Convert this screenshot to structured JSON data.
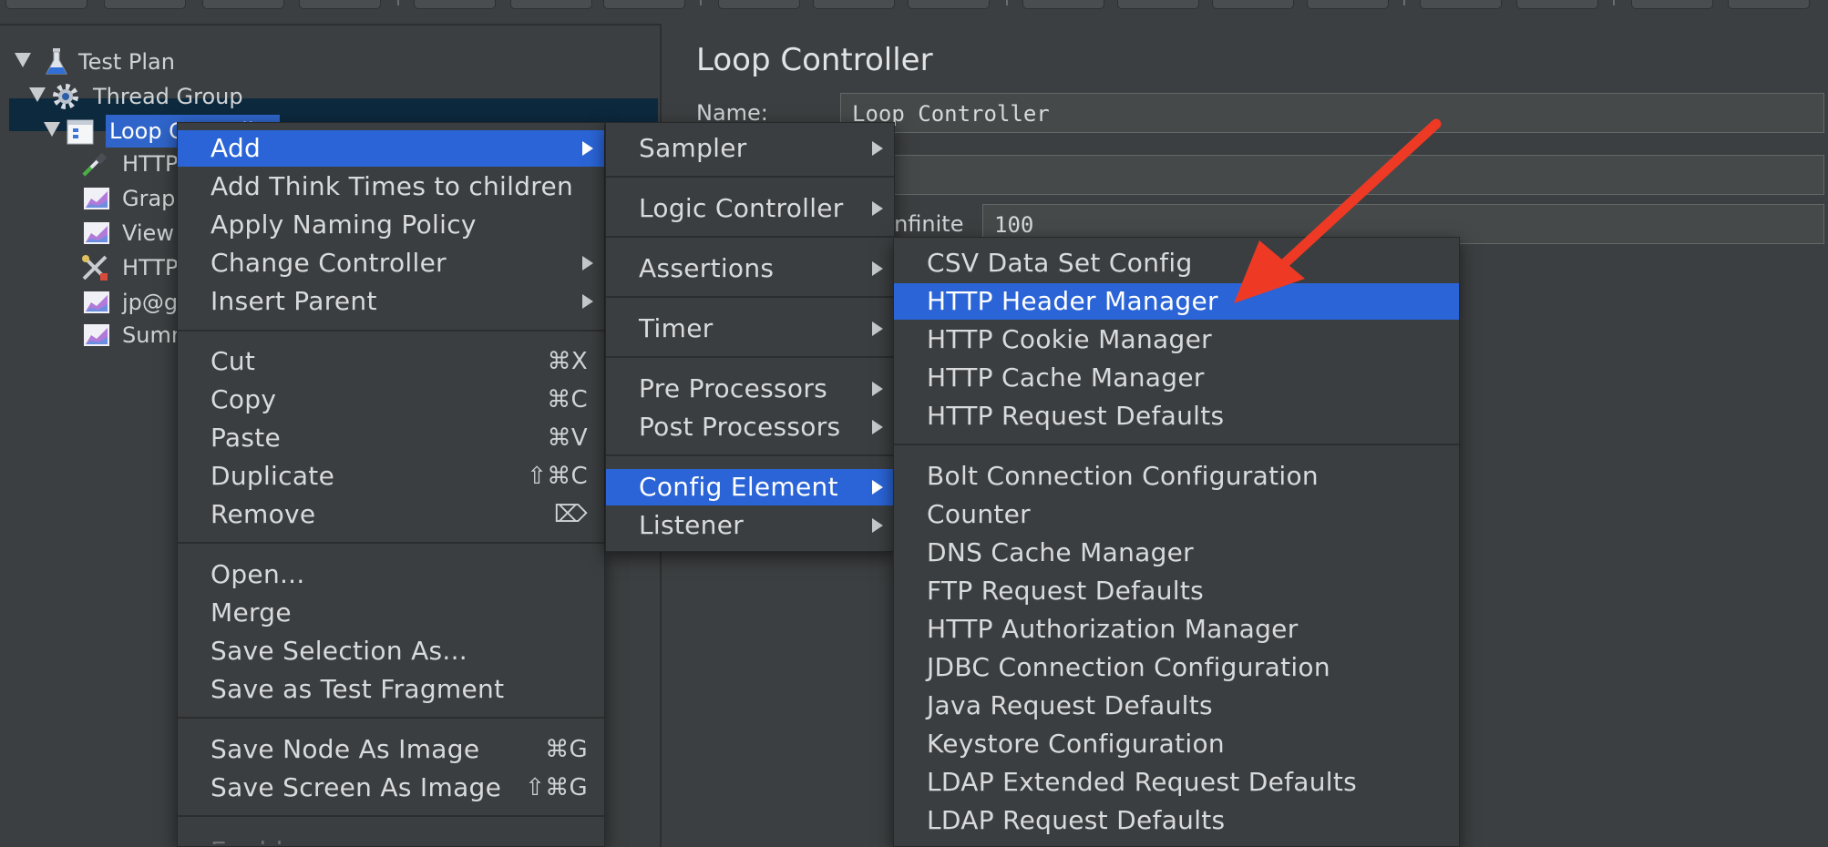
{
  "tree": {
    "nodes": [
      {
        "label": "Test Plan",
        "icon": "flask-icon"
      },
      {
        "label": "Thread Group",
        "icon": "gear-icon"
      },
      {
        "label": "Loop Controller",
        "icon": "loop-controller-icon"
      },
      {
        "label": "HTTP",
        "icon": "pipette-icon"
      },
      {
        "label": "Grap",
        "icon": "graph-listener-icon"
      },
      {
        "label": "View",
        "icon": "graph-listener-icon"
      },
      {
        "label": "HTTP",
        "icon": "tools-icon"
      },
      {
        "label": "jp@g",
        "icon": "graph-listener-icon"
      },
      {
        "label": "Summ",
        "icon": "graph-listener-icon"
      }
    ]
  },
  "panel": {
    "title": "Loop Controller",
    "name_label": "Name:",
    "name_value": "Loop Controller",
    "infinite_label": "Infinite",
    "loop_value": "100"
  },
  "context_menu": {
    "items": [
      {
        "label": "Add",
        "submenu": true,
        "highlighted": true
      },
      {
        "label": "Add Think Times to children"
      },
      {
        "label": "Apply Naming Policy"
      },
      {
        "label": "Change Controller",
        "submenu": true
      },
      {
        "label": "Insert Parent",
        "submenu": true
      },
      {
        "label": "Cut",
        "shortcut": "⌘X"
      },
      {
        "label": "Copy",
        "shortcut": "⌘C"
      },
      {
        "label": "Paste",
        "shortcut": "⌘V"
      },
      {
        "label": "Duplicate",
        "shortcut": "⇧⌘C"
      },
      {
        "label": "Remove",
        "shortcut": "⌦"
      },
      {
        "label": "Open..."
      },
      {
        "label": "Merge"
      },
      {
        "label": "Save Selection As..."
      },
      {
        "label": "Save as Test Fragment"
      },
      {
        "label": "Save Node As Image",
        "shortcut": "⌘G"
      },
      {
        "label": "Save Screen As Image",
        "shortcut": "⇧⌘G"
      },
      {
        "label": "Enable"
      }
    ]
  },
  "add_submenu": {
    "items": [
      {
        "label": "Sampler"
      },
      {
        "label": "Logic Controller"
      },
      {
        "label": "Assertions"
      },
      {
        "label": "Timer"
      },
      {
        "label": "Pre Processors"
      },
      {
        "label": "Post Processors"
      },
      {
        "label": "Config Element",
        "highlighted": true
      },
      {
        "label": "Listener"
      }
    ]
  },
  "config_submenu": {
    "items": [
      {
        "label": "CSV Data Set Config"
      },
      {
        "label": "HTTP Header Manager",
        "highlighted": true
      },
      {
        "label": "HTTP Cookie Manager"
      },
      {
        "label": "HTTP Cache Manager"
      },
      {
        "label": "HTTP Request Defaults"
      },
      {
        "label": "Bolt Connection Configuration"
      },
      {
        "label": "Counter"
      },
      {
        "label": "DNS Cache Manager"
      },
      {
        "label": "FTP Request Defaults"
      },
      {
        "label": "HTTP Authorization Manager"
      },
      {
        "label": "JDBC Connection Configuration"
      },
      {
        "label": "Java Request Defaults"
      },
      {
        "label": "Keystore Configuration"
      },
      {
        "label": "LDAP Extended Request Defaults"
      },
      {
        "label": "LDAP Request Defaults"
      }
    ]
  },
  "colors": {
    "background": "#3c3f41",
    "menu_highlight": "#2a64d6",
    "tree_selection": "#2f65ca",
    "annotation_arrow": "#ee3a24"
  }
}
